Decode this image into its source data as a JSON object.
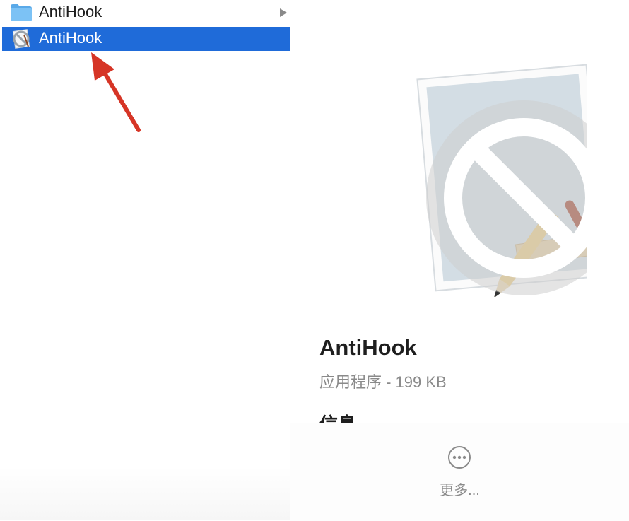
{
  "file_list": {
    "items": [
      {
        "name": "AntiHook",
        "icon": "folder-icon",
        "has_children": true,
        "selected": false
      },
      {
        "name": "AntiHook",
        "icon": "app-icon",
        "has_children": false,
        "selected": true
      }
    ]
  },
  "preview": {
    "icon": "app-icon-prohibited",
    "title": "AntiHook",
    "subtitle": "应用程序 - 199 KB",
    "section_heading": "信息",
    "more_label": "更多...",
    "more_icon": "more-icon"
  },
  "annotation": {
    "icon": "red-arrow",
    "color": "#d63526"
  },
  "colors": {
    "selection": "#1f6bd9",
    "text_primary": "#1e1e1e",
    "text_secondary": "#8a8a8a",
    "folder": "#69b6f0"
  }
}
